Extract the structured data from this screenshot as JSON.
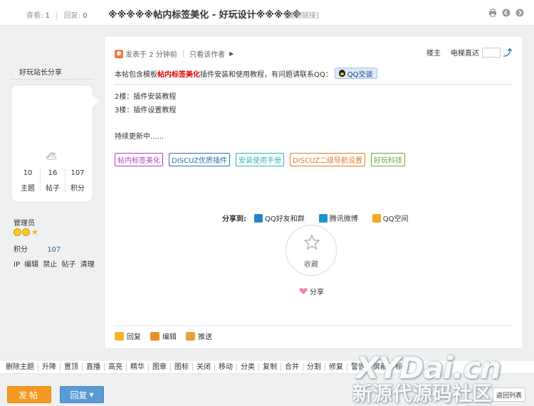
{
  "header": {
    "views_label": "查看:",
    "views": "1",
    "replies_label": "回复:",
    "replies": "0",
    "title": "※※※※※帖内标签美化 - 好玩设计※※※※※",
    "copy_link": "[复制链接]"
  },
  "author": {
    "name": "好玩站长分享",
    "stats": [
      {
        "value": "10",
        "label": "主题"
      },
      {
        "value": "16",
        "label": "帖子"
      },
      {
        "value": "107",
        "label": "积分"
      }
    ],
    "role": "管理员",
    "points_label": "积分",
    "points": "107",
    "mod_links": [
      "IP",
      "编辑",
      "禁止",
      "帖子",
      "清理"
    ]
  },
  "post": {
    "posted_label": "发表于",
    "posted_time": "2 分钟前",
    "only_author": "只看该作者",
    "floor": "楼主",
    "floor_jump": "电梯直达",
    "intro_before": "本帖包含模板",
    "intro_highlight": "帖内标签美化",
    "intro_after": "插件安装和使用教程，有问题请联系QQ：",
    "qq_button": "QQ交谈",
    "lines": [
      "2楼：插件安装教程",
      "3楼：插件设置教程"
    ],
    "continue": "持续更新中......",
    "tags": [
      {
        "label": "帖内标签美化",
        "color": "#b03fb8"
      },
      {
        "label": "DISCUZ优质插件",
        "color": "#2f6fb3"
      },
      {
        "label": "安装使用手册",
        "color": "#33b3b8"
      },
      {
        "label": "DISCUZ二级导航设置",
        "color": "#e07a2a"
      },
      {
        "label": "好玩科技",
        "color": "#6ea33a"
      }
    ],
    "share_to_label": "分享到:",
    "share_targets": [
      {
        "label": "QQ好友和群",
        "icon": "qq-icon",
        "color": "#2a82c9"
      },
      {
        "label": "腾讯微博",
        "icon": "tencent-weibo-icon",
        "color": "#1b96c8"
      },
      {
        "label": "QQ空间",
        "icon": "qzone-icon",
        "color": "#f0a81f"
      }
    ],
    "favorite": "收藏",
    "share": "分享",
    "actions": [
      {
        "label": "回复",
        "icon": "reply-icon",
        "color": "#f2b522"
      },
      {
        "label": "编辑",
        "icon": "edit-icon",
        "color": "#e7902a"
      },
      {
        "label": "推送",
        "icon": "push-icon",
        "color": "#e9a23a"
      }
    ]
  },
  "moderation": [
    "删除主题",
    "升降",
    "置顶",
    "直播",
    "高亮",
    "精华",
    "图章",
    "图标",
    "关闭",
    "移动",
    "分类",
    "复制",
    "合并",
    "分割",
    "修复",
    "警告",
    "屏蔽",
    "标签"
  ],
  "bottom": {
    "post_button": "发帖",
    "reply_button": "回复",
    "back_button": "返回列表"
  },
  "watermark": {
    "line1": "XYDai.cn",
    "line2": "新源代源码社区"
  }
}
